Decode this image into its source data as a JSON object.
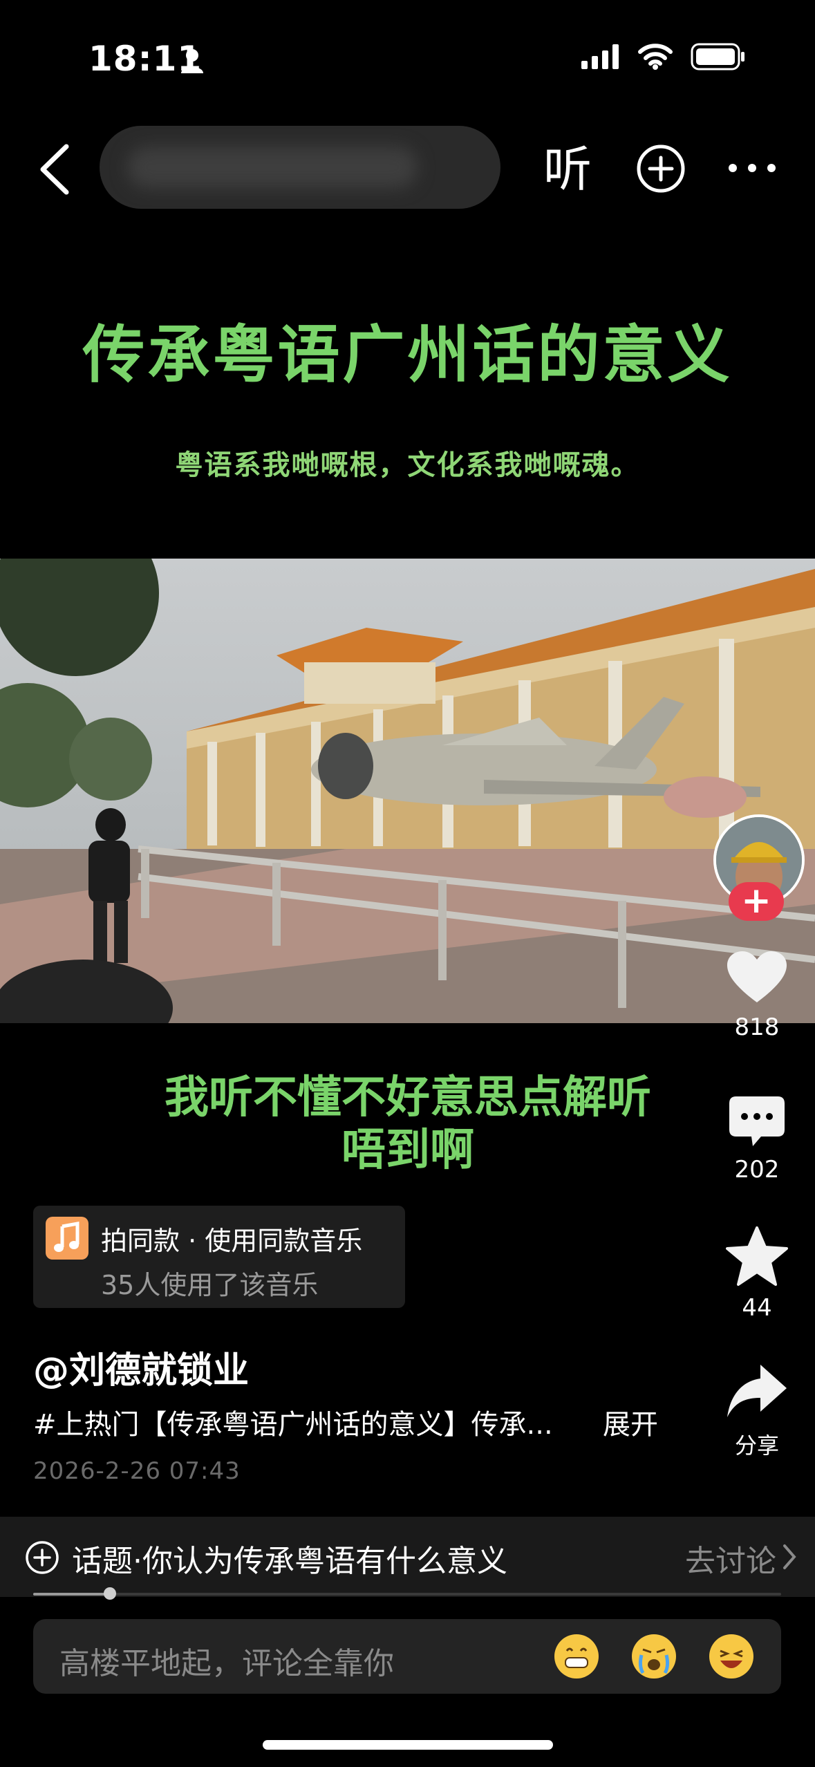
{
  "status_bar": {
    "time": "18:11"
  },
  "top_bar": {
    "listen_label": "听"
  },
  "video": {
    "title": "传承粤语广州话的意义",
    "subtitle": "粤语系我哋嘅根，文化系我哋嘅魂。",
    "caption_line1": "我听不懂不好意思点解听",
    "caption_line2": "唔到啊"
  },
  "actions": {
    "likes": "818",
    "comments": "202",
    "favorites": "44",
    "share_label": "分享"
  },
  "music": {
    "title": "拍同款 · 使用同款音乐",
    "usage": "35人使用了该音乐"
  },
  "post": {
    "author": "@刘德就锁业",
    "description": "#上热门【传承粤语广州话的意义】传承...",
    "expand_label": "展开",
    "date": "2026-2-26 07:43"
  },
  "topic": {
    "text": "话题·你认为传承粤语有什么意义",
    "action_label": "去讨论"
  },
  "progress": {
    "value": 0.103
  },
  "comment_input": {
    "placeholder": "高楼平地起，评论全靠你"
  },
  "emojis": [
    "grin-emoji",
    "cry-emoji",
    "laugh-emoji"
  ]
}
